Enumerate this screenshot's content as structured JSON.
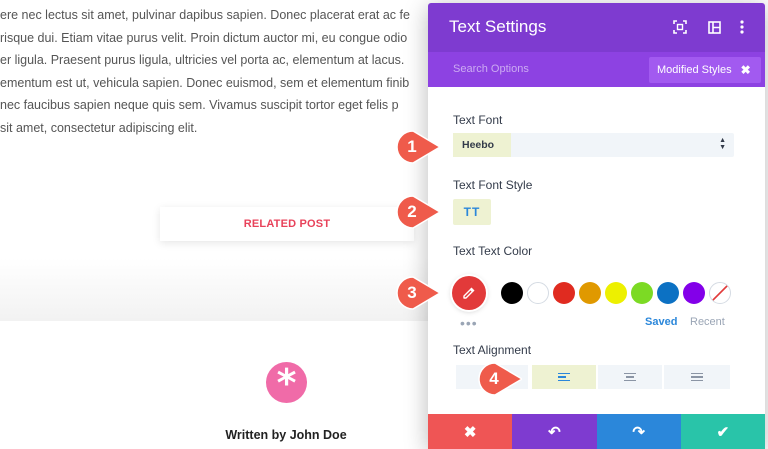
{
  "background": {
    "paragraph_lines": [
      "ere nec lectus sit amet, pulvinar dapibus sapien. Donec placerat erat ac fe",
      "risque dui. Etiam vitae purus velit. Proin dictum auctor mi, eu congue odio",
      "er ligula. Praesent purus ligula, ultricies vel porta ac, elementum at lacus.",
      "ementum est ut, vehicula sapien. Donec euismod, sem et elementum finib",
      "nec faucibus sapien neque quis sem. Vivamus suscipit tortor eget felis p",
      "sit amet, consectetur adipiscing elit."
    ],
    "related_post_label": "RELATED POST",
    "author_line": "Written by John Doe",
    "author_icon": "asterisk-icon"
  },
  "panel": {
    "title": "Text Settings",
    "header_icons": [
      "expand-icon",
      "sidebar-layout-icon",
      "more-vertical-icon"
    ],
    "search_placeholder": "Search Options",
    "filter_chip": {
      "label": "Modified Styles",
      "close_glyph": "✖"
    },
    "text_font": {
      "label": "Text Font",
      "value": "Heebo"
    },
    "text_font_style": {
      "label": "Text Font Style",
      "toggle_label": "TT"
    },
    "text_color": {
      "label": "Text Text Color",
      "current_color": "#e23a3a",
      "swatches": [
        "#000000",
        "#ffffff",
        "#e02b20",
        "#e09900",
        "#edf000",
        "#7cda24",
        "#0c71c3",
        "#8300e9",
        "none"
      ],
      "more_glyph": "•••",
      "saved_label": "Saved",
      "recent_label": "Recent"
    },
    "text_alignment": {
      "label": "Text Alignment",
      "options": [
        "left",
        "center",
        "right",
        "justify"
      ],
      "selected": "left"
    },
    "footer_buttons": [
      {
        "action": "cancel",
        "glyph": "✖",
        "color": "#ef5555"
      },
      {
        "action": "undo",
        "glyph": "↶",
        "color": "#7e3bd0"
      },
      {
        "action": "redo",
        "glyph": "↷",
        "color": "#2b87da"
      },
      {
        "action": "save",
        "glyph": "✔",
        "color": "#29c4a9"
      }
    ]
  },
  "step_markers": [
    "1",
    "2",
    "3",
    "4"
  ],
  "colors": {
    "header_purple": "#7e3bd0",
    "search_purple": "#8d42e2",
    "accent_blue": "#2b87da",
    "marker_red": "#ef5b4b",
    "highlight_yellow": "#eef2d2"
  }
}
